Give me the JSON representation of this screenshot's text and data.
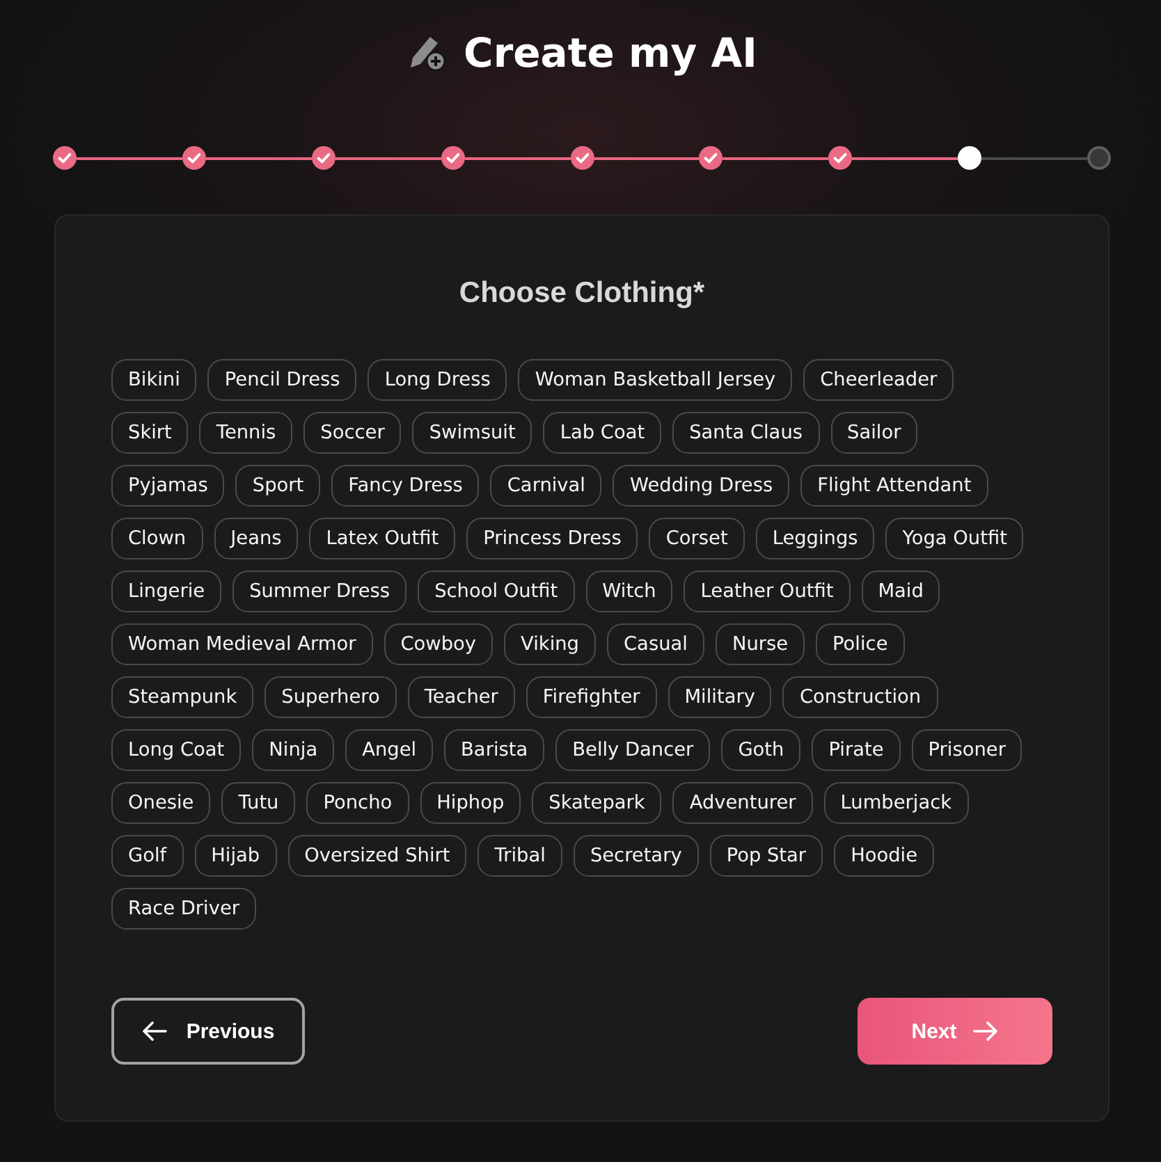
{
  "header": {
    "title": "Create my AI"
  },
  "steps": [
    {
      "completed": true,
      "current": false
    },
    {
      "completed": true,
      "current": false
    },
    {
      "completed": true,
      "current": false
    },
    {
      "completed": true,
      "current": false
    },
    {
      "completed": true,
      "current": false
    },
    {
      "completed": true,
      "current": false
    },
    {
      "completed": true,
      "current": false
    },
    {
      "completed": false,
      "current": true
    },
    {
      "completed": false,
      "current": false
    }
  ],
  "section": {
    "title": "Choose Clothing*",
    "option_rows": [
      [
        {
          "label": "Bikini",
          "selected": false
        },
        {
          "label": "Pencil Dress",
          "selected": false
        },
        {
          "label": "Long Dress",
          "selected": false
        },
        {
          "label": "Woman Basketball Jersey",
          "selected": false
        },
        {
          "label": "Cheerleader",
          "selected": false
        }
      ],
      [
        {
          "label": "Skirt",
          "selected": false
        },
        {
          "label": "Tennis",
          "selected": false
        },
        {
          "label": "Soccer",
          "selected": false
        },
        {
          "label": "Swimsuit",
          "selected": false
        },
        {
          "label": "Lab Coat",
          "selected": false
        },
        {
          "label": "Santa Claus",
          "selected": false
        },
        {
          "label": "Sailor",
          "selected": false
        }
      ],
      [
        {
          "label": "Pyjamas",
          "selected": false
        },
        {
          "label": "Sport",
          "selected": false
        },
        {
          "label": "Fancy Dress",
          "selected": false
        },
        {
          "label": "Carnival",
          "selected": false
        },
        {
          "label": "Wedding Dress",
          "selected": false
        },
        {
          "label": "Flight Attendant",
          "selected": false
        }
      ],
      [
        {
          "label": "Clown",
          "selected": false
        },
        {
          "label": "Jeans",
          "selected": false
        },
        {
          "label": "Latex Outfit",
          "selected": false
        },
        {
          "label": "Princess Dress",
          "selected": false
        },
        {
          "label": "Corset",
          "selected": false
        },
        {
          "label": "Leggings",
          "selected": false
        },
        {
          "label": "Yoga Outfit",
          "selected": false
        }
      ],
      [
        {
          "label": "Lingerie",
          "selected": false
        },
        {
          "label": "Summer Dress",
          "selected": false
        },
        {
          "label": "School Outfit",
          "selected": false
        },
        {
          "label": "Witch",
          "selected": false
        },
        {
          "label": "Leather Outfit",
          "selected": false
        },
        {
          "label": "Maid",
          "selected": false
        }
      ],
      [
        {
          "label": "Woman Medieval Armor",
          "selected": false
        },
        {
          "label": "Cowboy",
          "selected": false
        },
        {
          "label": "Viking",
          "selected": false
        },
        {
          "label": "Casual",
          "selected": false
        },
        {
          "label": "Nurse",
          "selected": false
        },
        {
          "label": "Police",
          "selected": false
        }
      ],
      [
        {
          "label": "Steampunk",
          "selected": false
        },
        {
          "label": "Superhero",
          "selected": false
        },
        {
          "label": "Teacher",
          "selected": false
        },
        {
          "label": "Firefighter",
          "selected": false
        },
        {
          "label": "Military",
          "selected": false
        },
        {
          "label": "Construction",
          "selected": false
        }
      ],
      [
        {
          "label": "Long Coat",
          "selected": false
        },
        {
          "label": "Ninja",
          "selected": false
        },
        {
          "label": "Angel",
          "selected": false
        },
        {
          "label": "Barista",
          "selected": false
        },
        {
          "label": "Belly Dancer",
          "selected": false
        },
        {
          "label": "Goth",
          "selected": false
        },
        {
          "label": "Pirate",
          "selected": false
        },
        {
          "label": "Prisoner",
          "selected": false
        }
      ],
      [
        {
          "label": "Onesie",
          "selected": false
        },
        {
          "label": "Tutu",
          "selected": false
        },
        {
          "label": "Poncho",
          "selected": false
        },
        {
          "label": "Hiphop",
          "selected": false
        },
        {
          "label": "Skatepark",
          "selected": false
        },
        {
          "label": "Adventurer",
          "selected": false
        },
        {
          "label": "Lumberjack",
          "selected": false
        }
      ],
      [
        {
          "label": "Golf",
          "selected": false
        },
        {
          "label": "Hijab",
          "selected": false
        },
        {
          "label": "Oversized Shirt",
          "selected": false
        },
        {
          "label": "Tribal",
          "selected": false
        },
        {
          "label": "Secretary",
          "selected": false
        },
        {
          "label": "Pop Star",
          "selected": false
        },
        {
          "label": "Hoodie",
          "selected": false
        }
      ],
      [
        {
          "label": "Race Driver",
          "selected": false
        }
      ]
    ]
  },
  "buttons": [
    {
      "kind": "back",
      "label": "Previous"
    },
    {
      "kind": "next",
      "label": "Next"
    }
  ]
}
